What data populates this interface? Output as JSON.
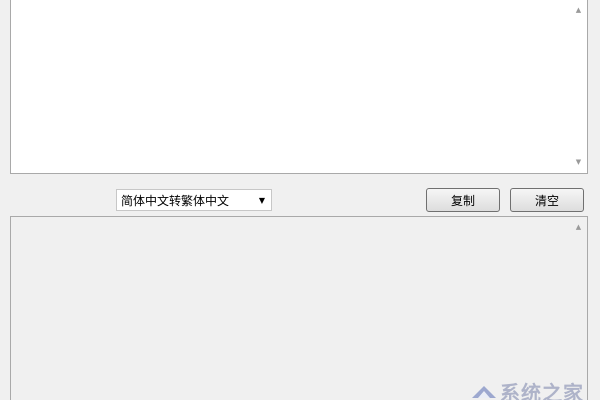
{
  "converter": {
    "mode_select": {
      "selected": "简体中文转繁体中文"
    },
    "copy_button": "复制",
    "clear_button": "清空"
  },
  "input_area": {
    "value": ""
  },
  "output_area": {
    "value": ""
  },
  "icons": {
    "scroll_up": "scroll-up-arrow",
    "scroll_down": "scroll-down-arrow",
    "select_dropdown": "dropdown-arrow"
  },
  "watermark": {
    "text": "系统之家"
  }
}
